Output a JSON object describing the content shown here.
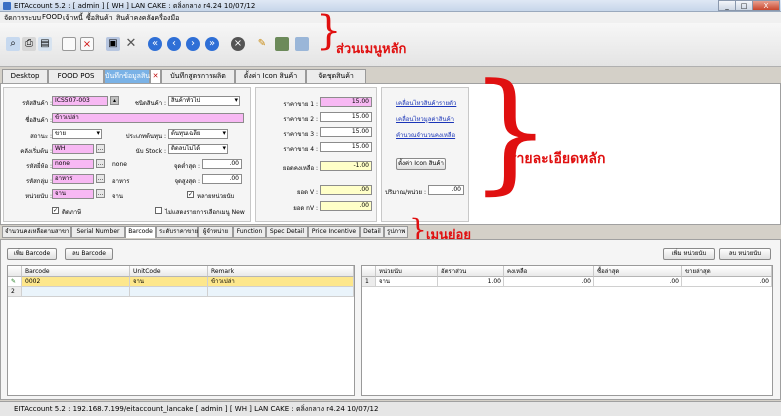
{
  "window": {
    "title": "EITAccount  5.2 : [ admin ] [ WH ]     LAN CAKE : ตลิ่งกลาง     r4.24 10/07/12",
    "minimize": "_",
    "maximize": "□",
    "close": "X"
  },
  "menu": [
    "จัดการระบบ",
    "FOOD",
    "เจ้าหนี้",
    "ซื้อสินค้า",
    "สินค้าคงคลัง",
    "เครื่องมือ"
  ],
  "toolbar": {
    "icons": [
      "search-icon",
      "print-icon",
      "print-preview-icon",
      "new-document-icon",
      "delete-icon",
      "save-icon",
      "cancel-icon",
      "first-record-icon",
      "previous-record-icon",
      "next-record-icon",
      "last-record-icon",
      "close-form-icon",
      "edit-icon",
      "list-icon",
      "export-icon"
    ]
  },
  "annotations": {
    "main_menu": "ส่วนเมนูหลัก",
    "main_detail": "รายละเอียดหลัก",
    "sub_menu": "เมนูย่อย"
  },
  "tabs": [
    "Desktop",
    "FOOD POS",
    "บันทึกข้อมูลสินค้า",
    "บันทึกสูตรการผลิต",
    "ตั้งค่า Icon สินค้า",
    "จัดชุดสินค้า"
  ],
  "form": {
    "product_code_label": "รหัสสินค้า :",
    "product_code": "ICS507-003",
    "product_type_label": "ชนิดสินค้า :",
    "product_type": "สินค้าทั่วไป",
    "product_name_label": "ชื่อสินค้า :",
    "product_name": "ข้าวเปล่า",
    "status_label": "สถานะ :",
    "status": "ขาย",
    "cost_method_label": "ประเภทต้นทุน :",
    "cost_method": "ต้นทุนเฉลี่ย",
    "warehouse_label": "คลังเริ่มต้น :",
    "warehouse": "WH",
    "stock_type_label": "นับ Stock :",
    "stock_type": "ติดลบไม่ได้",
    "unit_group_label": "รหัสยี่ห้อ :",
    "unit_group": "none",
    "unit_group_name": "none",
    "min_point_label": "จุดต่ำสุด :",
    "min_point": ".00",
    "category_label": "รหัสกลุ่ม :",
    "category": "อาหาร",
    "category_name": "อาหาร",
    "max_point_label": "จุดสูงสุด :",
    "max_point": ".00",
    "unit_label": "หน่วยนับ :",
    "unit": "จาน",
    "unit_name": "จาน",
    "multi_unit_label": "หลายหน่วยนับ",
    "tax_label": "ติดภาษี",
    "no_popup_label": "ไม่แสดงรายการเลือกเมนู New",
    "price_labels": [
      "ราคาขาย 1 :",
      "ราคาขาย 2 :",
      "ราคาขาย 3 :",
      "ราคาขาย 4 :"
    ],
    "prices": [
      "15.00",
      "15.00",
      "15.00",
      "15.00"
    ],
    "balance_label": "ยอดคงเหลือ :",
    "balance": "-1.00",
    "cost_v_label": "ยอด V :",
    "cost_v": ".00",
    "cost_nv_label": "ยอด nV :",
    "cost_nv": ".00",
    "links": [
      "เคลื่อนไหวสินค้ารายตัว",
      "เคลื่อนไหวมูลค่าสินค้า",
      "คำนวณจำนวนคงเหลือ"
    ],
    "icon_button": "ตั้งค่า Icon สินค้า",
    "qty_per_unit_label": "ปริมาณ/หน่วย :",
    "qty_per_unit": ".00"
  },
  "subtabs": [
    "จำนวนคงเหลือตามสาขา",
    "Serial Number",
    "Barcode",
    "ระดับราคาขาย",
    "ผู้จำหน่าย",
    "Function",
    "Spec Detail",
    "Price Incentive",
    "Detail",
    "รูปภาพ"
  ],
  "barcode_grid": {
    "add_button": "เพิ่ม Barcode",
    "delete_button": "ลบ Barcode",
    "columns": [
      "Barcode",
      "UnitCode",
      "Remark"
    ],
    "rows": [
      {
        "num": "1",
        "barcode": "0002",
        "unit": "จาน",
        "remark": "ข้าวเปล่า"
      },
      {
        "num": "2",
        "barcode": "",
        "unit": "",
        "remark": ""
      }
    ]
  },
  "unit_grid": {
    "add_button": "เพิ่ม หน่วยนับ",
    "delete_button": "ลบ หน่วยนับ",
    "columns": [
      "หน่วยนับ",
      "อัตราส่วน",
      "คงเหลือ",
      "ซื้อล่าสุด",
      "ขายล่าสุด"
    ],
    "rows": [
      {
        "num": "1",
        "unit": "จาน",
        "ratio": "1.00",
        "balance": ".00",
        "last_buy": ".00",
        "last_sell": ".00"
      }
    ]
  },
  "status": {
    "text": "EITAccount  5.2 : 192.168.7.199/eitaccount_lancake  [ admin ] [ WH ]    LAN CAKE : ตลิ่งกลาง     r4.24 10/07/12"
  }
}
